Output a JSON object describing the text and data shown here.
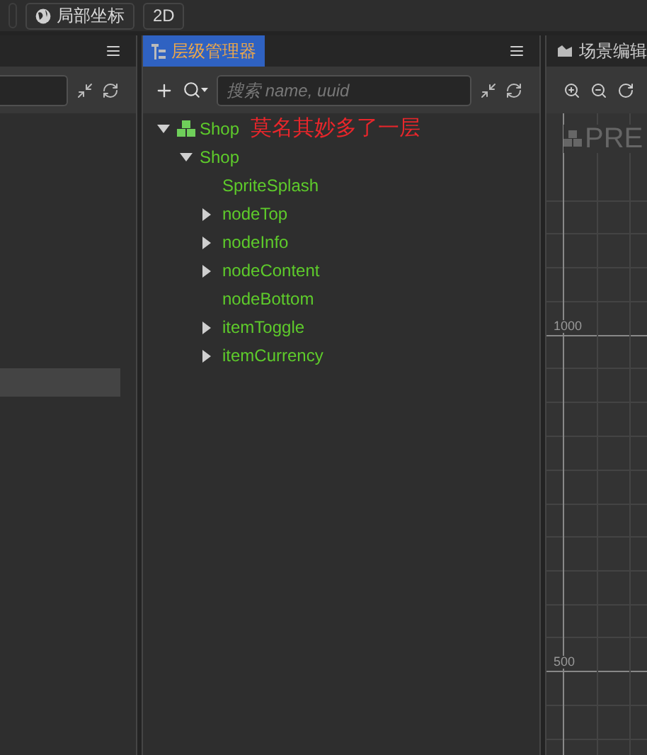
{
  "toolbar": {
    "buttons": [
      {
        "kind": "globe",
        "label": "局部坐标"
      },
      {
        "kind": "plain",
        "label": "2D"
      }
    ]
  },
  "hierarchy": {
    "title": "层级管理器",
    "selected": true,
    "search": {
      "placeholder": "搜索 name, uuid"
    },
    "tree": [
      {
        "label": "Shop",
        "kind": "scene",
        "expanded": true,
        "annotation": "莫名其妙多了一层",
        "children": [
          {
            "label": "Shop",
            "expanded": true,
            "children": [
              {
                "label": "SpriteSplash"
              },
              {
                "label": "nodeTop",
                "expanded": false
              },
              {
                "label": "nodeInfo",
                "expanded": false
              },
              {
                "label": "nodeContent",
                "expanded": false
              },
              {
                "label": "nodeBottom"
              },
              {
                "label": "itemToggle",
                "expanded": false
              },
              {
                "label": "itemCurrency",
                "expanded": false
              }
            ]
          }
        ]
      }
    ]
  },
  "scene": {
    "title": "场景编辑",
    "preview": "PRE",
    "ruler_labels": [
      "1000",
      "500"
    ]
  }
}
